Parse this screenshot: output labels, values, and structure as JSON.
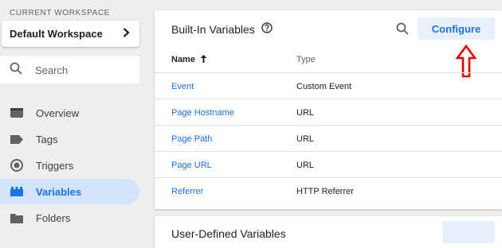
{
  "sidebar": {
    "workspace_label": "CURRENT WORKSPACE",
    "workspace_name": "Default Workspace",
    "search_placeholder": "Search",
    "items": [
      {
        "label": "Overview",
        "icon": "overview-icon"
      },
      {
        "label": "Tags",
        "icon": "tag-icon"
      },
      {
        "label": "Triggers",
        "icon": "trigger-icon"
      },
      {
        "label": "Variables",
        "icon": "variables-icon",
        "active": true
      },
      {
        "label": "Folders",
        "icon": "folder-icon"
      }
    ]
  },
  "builtin": {
    "title": "Built-In Variables",
    "configure_label": "Configure",
    "columns": {
      "name": "Name",
      "type": "Type"
    },
    "rows": [
      {
        "name": "Event",
        "type": "Custom Event"
      },
      {
        "name": "Page Hostname",
        "type": "URL"
      },
      {
        "name": "Page Path",
        "type": "URL"
      },
      {
        "name": "Page URL",
        "type": "URL"
      },
      {
        "name": "Referrer",
        "type": "HTTP Referrer"
      }
    ]
  },
  "user_defined": {
    "title": "User-Defined Variables"
  },
  "colors": {
    "accent": "#1a73e8",
    "active_bg": "#d2e3fc",
    "arrow": "#e00000"
  }
}
